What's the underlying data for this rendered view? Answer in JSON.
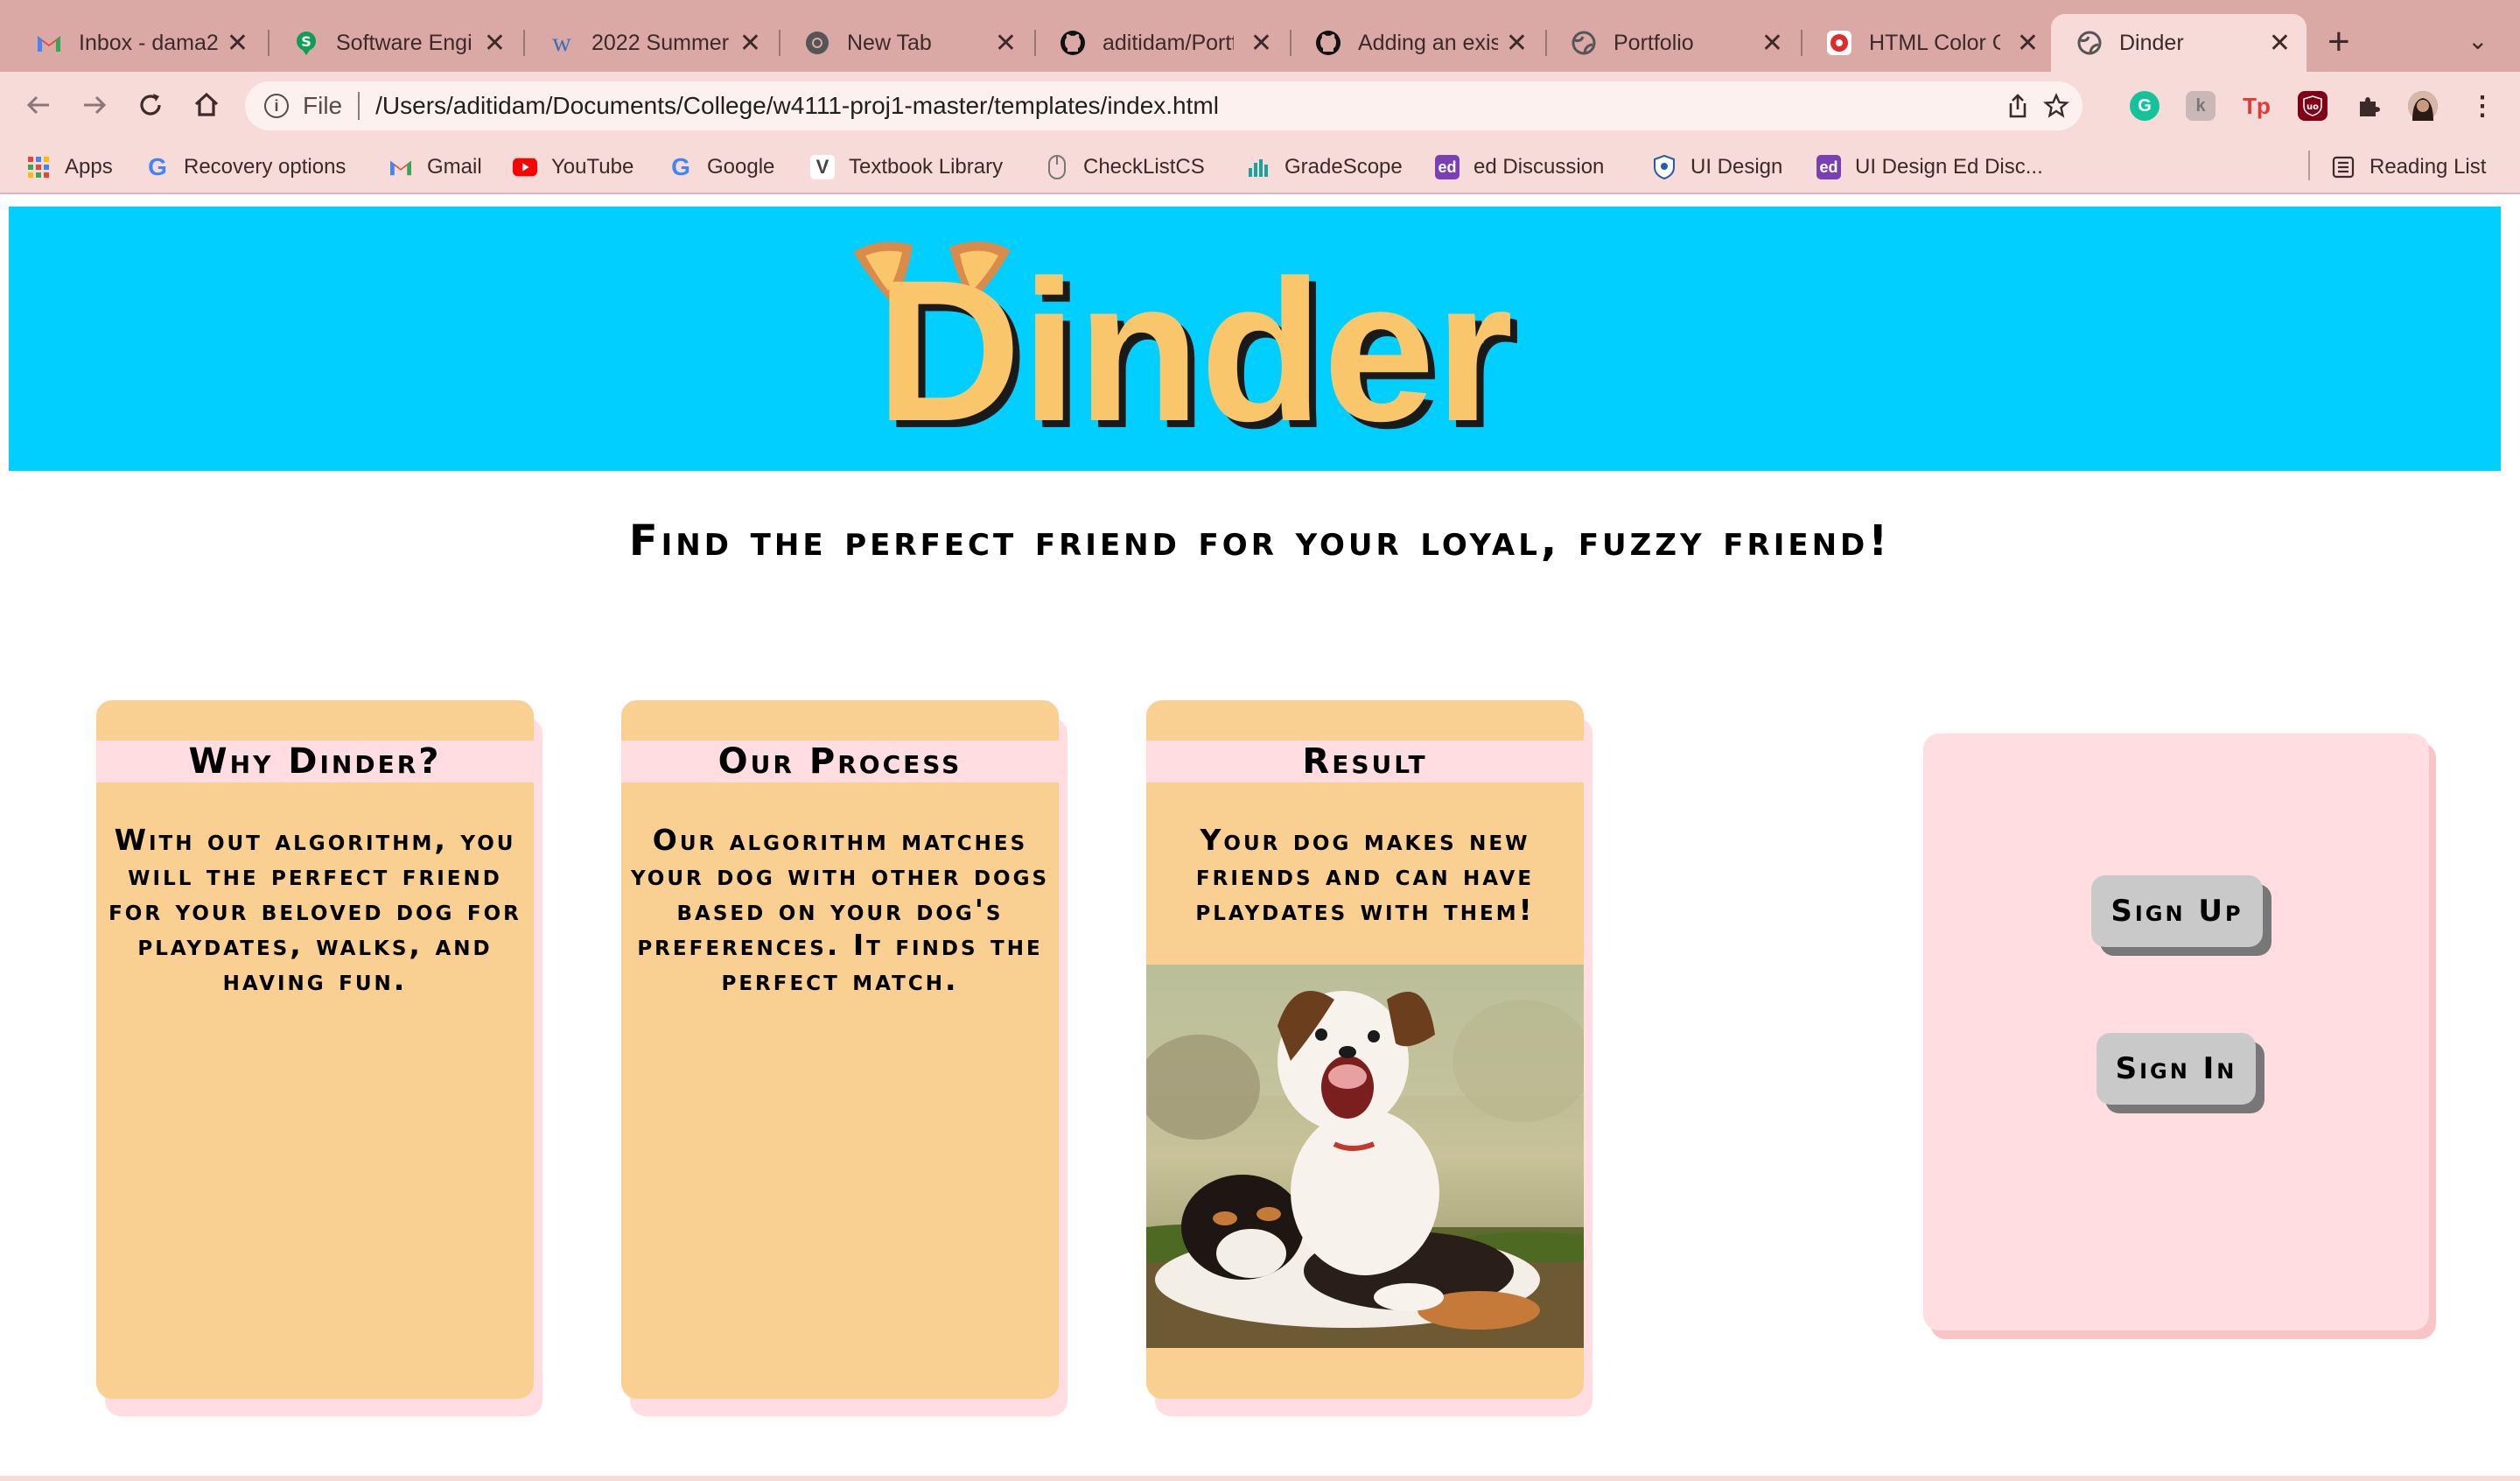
{
  "browser": {
    "tabs": [
      {
        "title": "Inbox - dama2",
        "icon": "gmail-icon",
        "active": false
      },
      {
        "title": "Software Engi",
        "icon": "software-icon",
        "active": false
      },
      {
        "title": "2022 Summer",
        "icon": "w-icon",
        "active": false
      },
      {
        "title": "New Tab",
        "icon": "chrome-icon",
        "active": false
      },
      {
        "title": "aditidam/Portf",
        "icon": "github-icon",
        "active": false
      },
      {
        "title": "Adding an exis",
        "icon": "github-icon",
        "active": false
      },
      {
        "title": "Portfolio",
        "icon": "globe-icon",
        "active": false
      },
      {
        "title": "HTML Color C",
        "icon": "colorpicker-icon",
        "active": false
      },
      {
        "title": "Dinder",
        "icon": "globe-icon",
        "active": true
      }
    ],
    "new_tab": "+",
    "address": {
      "scheme": "File",
      "url": "/Users/aditidam/Documents/College/w4111-proj1-master/templates/index.html"
    },
    "bookmarks": [
      {
        "label": "Apps",
        "icon": "apps-grid-icon"
      },
      {
        "label": "Recovery options",
        "icon": "google-icon"
      },
      {
        "label": "Gmail",
        "icon": "gmail-icon"
      },
      {
        "label": "YouTube",
        "icon": "youtube-icon"
      },
      {
        "label": "Google",
        "icon": "google-icon"
      },
      {
        "label": "Textbook Library",
        "icon": "textbook-icon"
      },
      {
        "label": "CheckListCS",
        "icon": "checklist-icon"
      },
      {
        "label": "GradeScope",
        "icon": "gradescope-icon"
      },
      {
        "label": "ed Discussion",
        "icon": "ed-icon"
      },
      {
        "label": "UI Design",
        "icon": "ui-design-icon"
      },
      {
        "label": "UI Design Ed Disc...",
        "icon": "ed-icon"
      }
    ],
    "reading_list": "Reading List",
    "colors": {
      "tabbar": "#dba9a5",
      "toolbar": "#f6dbd8"
    }
  },
  "page": {
    "logo_text": "Dinder",
    "tagline": "Find the perfect friend for your loyal, fuzzy friend!",
    "cards": [
      {
        "title": "Why Dinder?",
        "text": "With out algorithm, you will the perfect friend for your beloved dog for playdates, walks, and having fun."
      },
      {
        "title": "Our Process",
        "text": "Our algorithm matches your dog with other dogs based on your dog's preferences. It finds the perfect match."
      },
      {
        "title": "Result",
        "text": "Your dog makes new friends and can have playdates with them!"
      }
    ],
    "buttons": {
      "sign_up": "Sign Up",
      "sign_in": "Sign In"
    },
    "colors": {
      "banner": "#00cfff",
      "card": "#f9cf92",
      "card_header": "#ffdde0",
      "logo": "#f9c66b",
      "button": "#c9c9c9"
    }
  }
}
